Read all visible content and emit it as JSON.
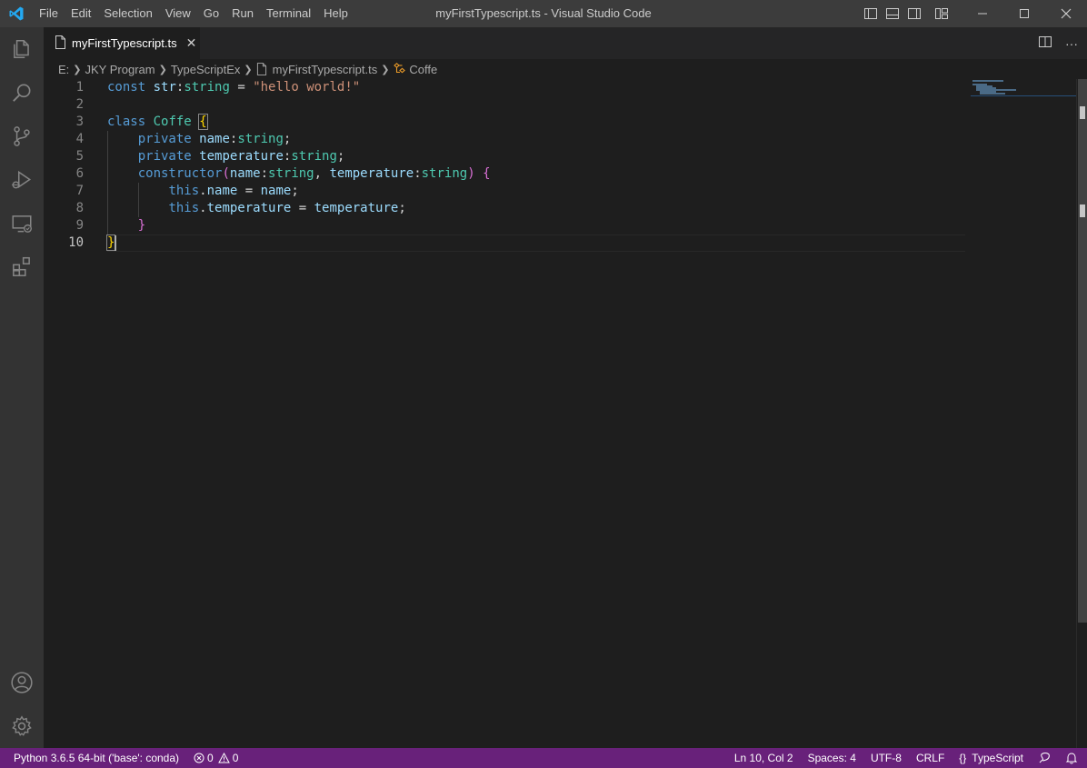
{
  "window": {
    "title": "myFirstTypescript.ts - Visual Studio Code"
  },
  "menu": {
    "items": [
      "File",
      "Edit",
      "Selection",
      "View",
      "Go",
      "Run",
      "Terminal",
      "Help"
    ]
  },
  "tab": {
    "label": "myFirstTypescript.ts",
    "close": "✕"
  },
  "editor_actions": {
    "more": "···"
  },
  "breadcrumbs": {
    "items": [
      "E:",
      "JKY Program",
      "TypeScriptEx",
      "myFirstTypescript.ts",
      "Coffe"
    ]
  },
  "editor": {
    "line_numbers": [
      "1",
      "2",
      "3",
      "4",
      "5",
      "6",
      "7",
      "8",
      "9",
      "10"
    ],
    "active_line": 10
  },
  "code": {
    "l1": {
      "a": "const",
      "b": " str",
      "c": ":",
      "d": "string",
      "e": " = ",
      "f": "\"hello world!\""
    },
    "l3": {
      "a": "class",
      "b": " ",
      "c": "Coffe",
      "d": " ",
      "e": "{"
    },
    "l4": {
      "a": "private",
      "b": " name",
      "c": ":",
      "d": "string",
      "e": ";"
    },
    "l5": {
      "a": "private",
      "b": " temperature",
      "c": ":",
      "d": "string",
      "e": ";"
    },
    "l6": {
      "a": "constructor",
      "b": "(",
      "c": "name",
      "d": ":",
      "e": "string",
      "f": ", ",
      "g": "temperature",
      "h": ":",
      "i": "string",
      "j": ")",
      "k": " ",
      "l": "{"
    },
    "l7": {
      "a": "this",
      "b": ".",
      "c": "name",
      "d": " = ",
      "e": "name",
      "f": ";"
    },
    "l8": {
      "a": "this",
      "b": ".",
      "c": "temperature",
      "d": " = ",
      "e": "temperature",
      "f": ";"
    },
    "l9": {
      "a": "}"
    },
    "l10": {
      "a": "}"
    }
  },
  "statusbar": {
    "python": "Python 3.6.5 64-bit ('base': conda)",
    "errors": "0",
    "warnings": "0",
    "position": "Ln 10, Col 2",
    "spaces": "Spaces: 4",
    "encoding": "UTF-8",
    "eol": "CRLF",
    "language_icon": "{}",
    "language": "TypeScript"
  },
  "colors": {
    "statusbar": "#68217a",
    "keyword": "#569cd6",
    "variable": "#9cdcfe",
    "type": "#4ec9b0",
    "string": "#ce9178",
    "bracket_level1": "#ffd700",
    "bracket_level2": "#da70d6"
  }
}
